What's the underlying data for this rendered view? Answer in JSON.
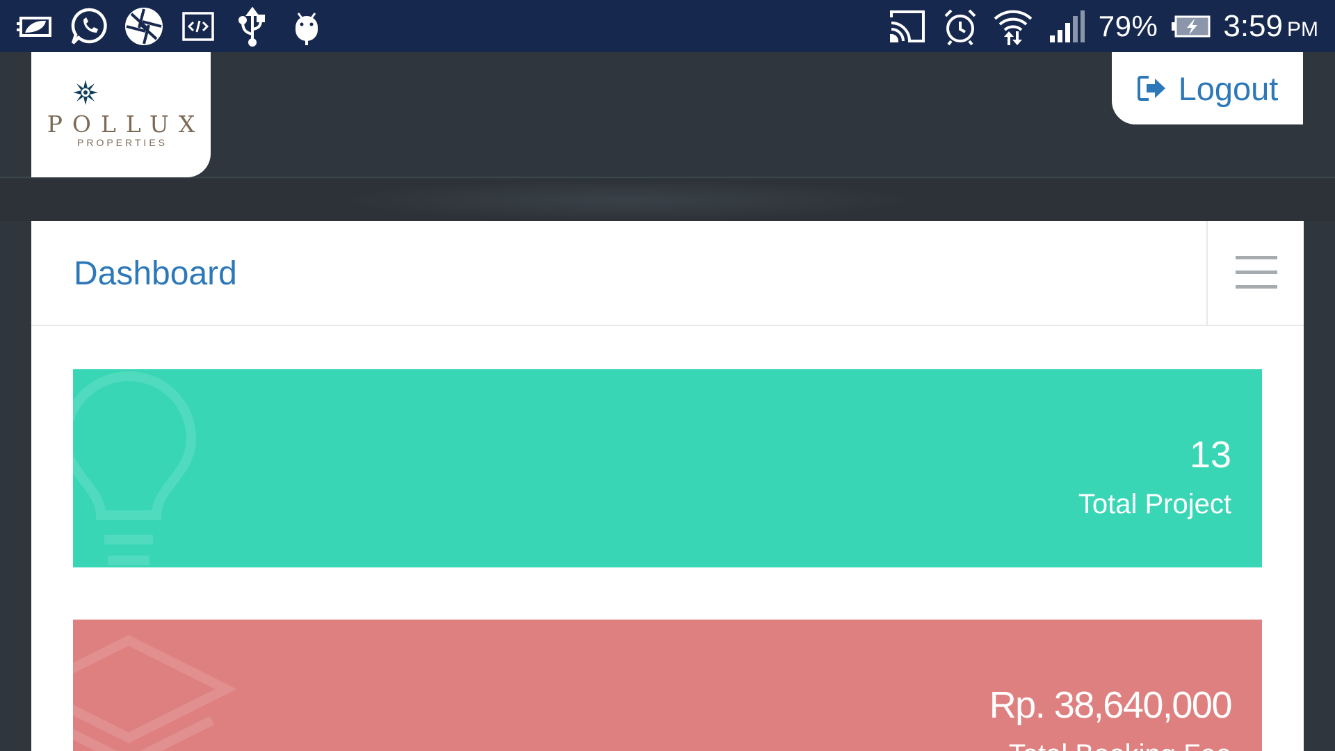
{
  "status_bar": {
    "left_icons": [
      "battery-saver-icon",
      "whatsapp-icon",
      "camera-aperture-icon",
      "code-tag-icon",
      "usb-icon",
      "android-debug-icon"
    ],
    "right_icons": [
      "cast-icon",
      "alarm-icon",
      "wifi-icon",
      "signal-icon",
      "battery-charging-icon"
    ],
    "battery_percent": "79%",
    "time": "3:59",
    "period": "PM"
  },
  "header": {
    "logo_name": "POLLUX",
    "logo_sub": "PROPERTIES",
    "logout_label": "Logout",
    "logout_icon": "sign-out-icon"
  },
  "page": {
    "title": "Dashboard",
    "menu_icon": "hamburger-menu-icon"
  },
  "stats": [
    {
      "value": "13",
      "label": "Total Project",
      "icon": "lightbulb-icon",
      "color": "#38d6b5"
    },
    {
      "value": "Rp. 38,640,000",
      "label": "Total Booking Fee",
      "icon": "layers-icon",
      "color": "#de8080"
    }
  ],
  "colors": {
    "status_bar": "#17284f",
    "header_bg": "#2f363e",
    "accent": "#2c78b8",
    "brand_text": "#7c6a55"
  }
}
